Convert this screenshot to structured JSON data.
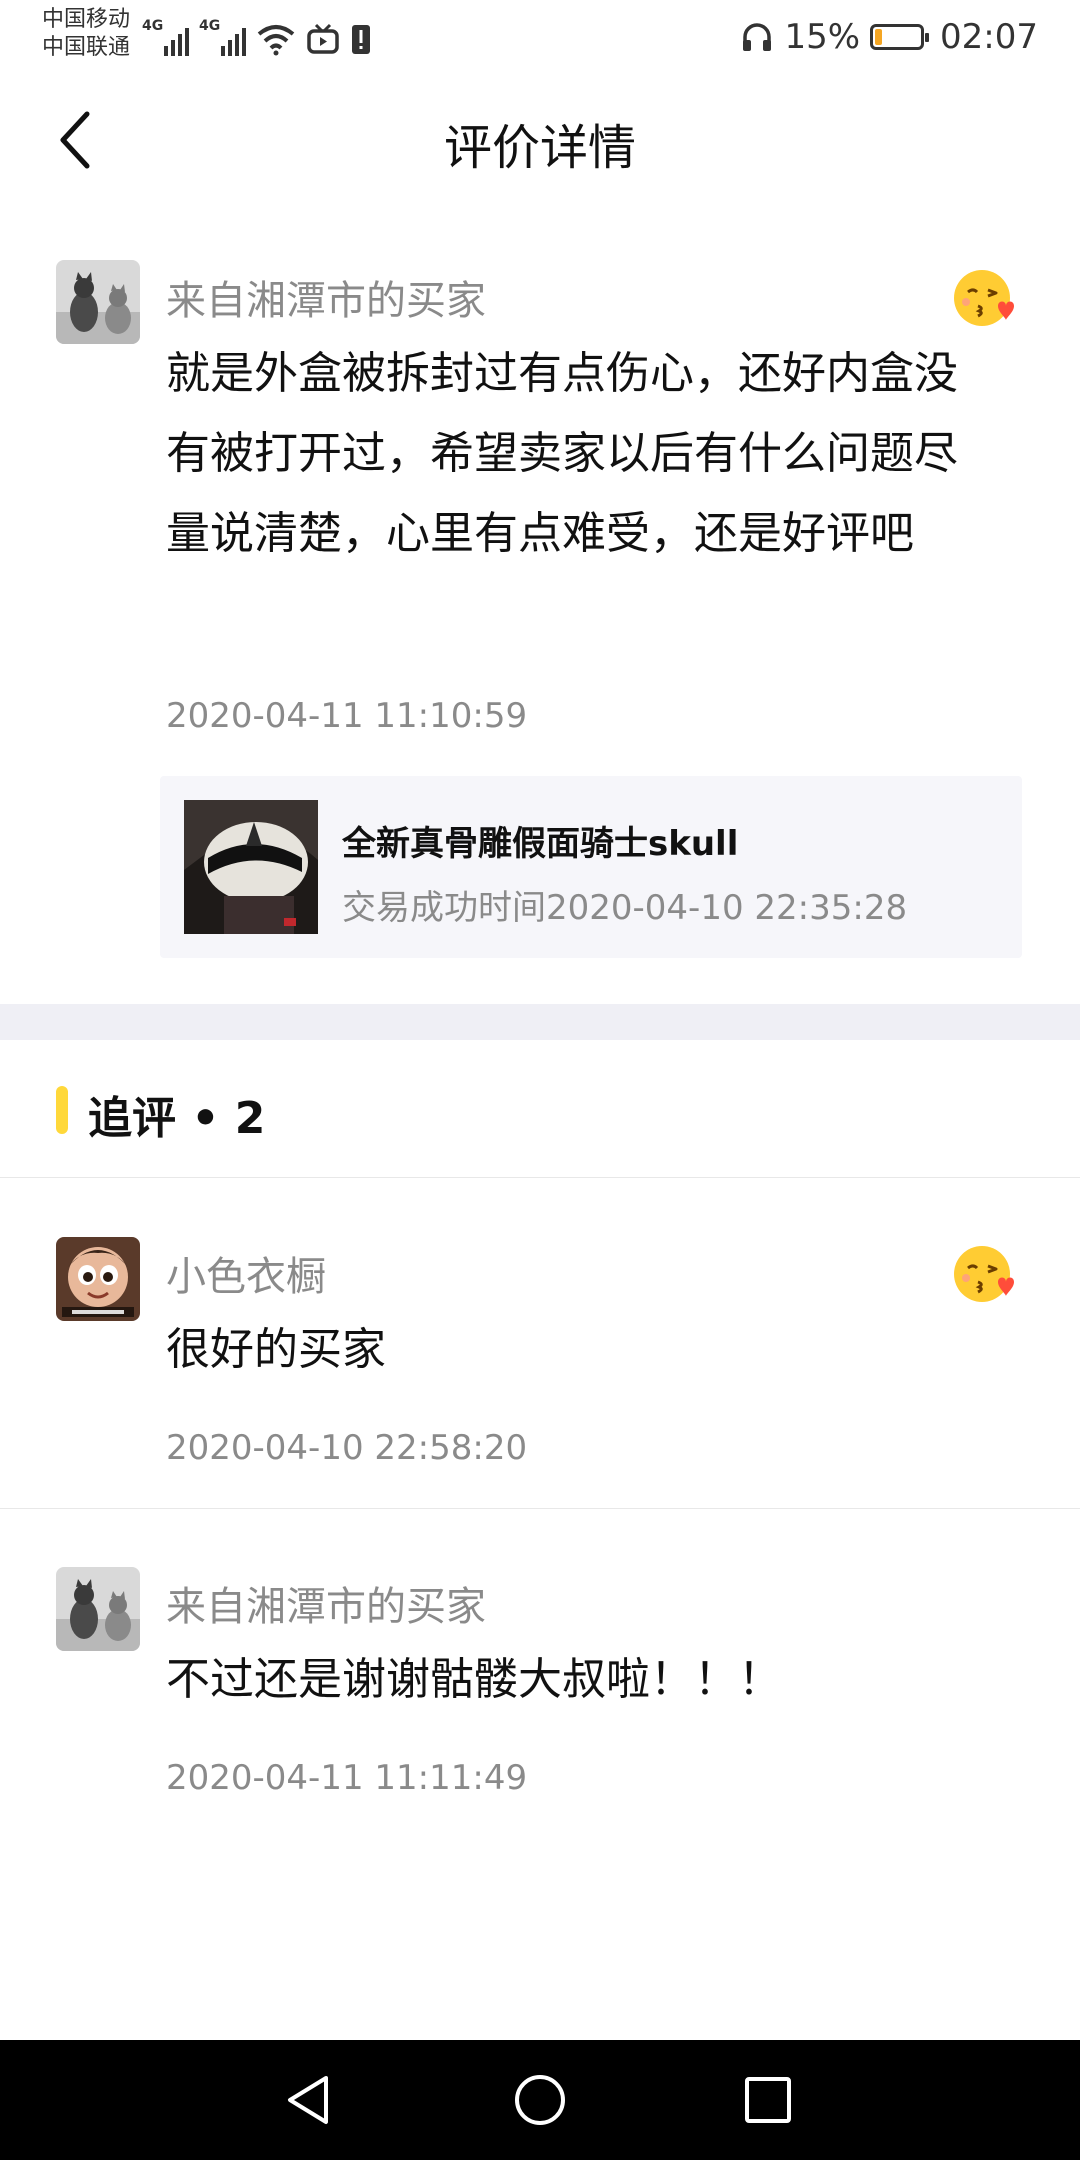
{
  "status_bar": {
    "carrier_1": "中国移动",
    "carrier_2": "中国联通",
    "network_1": "4G",
    "network_2": "4G",
    "battery_percent": "15%",
    "battery_level": 0.15,
    "time": "02:07",
    "icons": [
      "signal-icon",
      "signal-icon",
      "wifi-icon",
      "tv-icon",
      "alert-icon",
      "headphones-icon",
      "battery-icon"
    ]
  },
  "header": {
    "title": "评价详情",
    "back_icon": "chevron-left-icon"
  },
  "main_review": {
    "username": "来自湘潭市的买家",
    "content": "就是外盒被拆封过有点伤心，还好内盒没有被打开过，希望卖家以后有什么问题尽量说清楚，心里有点难受，还是好评吧",
    "timestamp": "2020-04-11 11:10:59",
    "emoji_icon": "kiss-heart-emoji-icon"
  },
  "product": {
    "name": "全新真骨雕假面骑士skull",
    "trade_time": "交易成功时间2020-04-10 22:35:28"
  },
  "followups": {
    "title": "追评 • 2",
    "items": [
      {
        "username": "小色衣橱",
        "content": "很好的买家",
        "timestamp": "2020-04-10 22:58:20",
        "emoji_icon": "kiss-heart-emoji-icon"
      },
      {
        "username": "来自湘潭市的买家",
        "content": "不过还是谢谢骷髅大叔啦！！！",
        "timestamp": "2020-04-11 11:11:49"
      }
    ]
  },
  "nav": {
    "icons": [
      "back-triangle-icon",
      "home-circle-icon",
      "recents-square-icon"
    ]
  },
  "colors": {
    "accent_bar": "#ffd83a",
    "muted_text": "#8a8a8a",
    "card_bg": "#f6f6fa",
    "band_bg": "#efeff5",
    "battery_fill": "#f5a623"
  }
}
